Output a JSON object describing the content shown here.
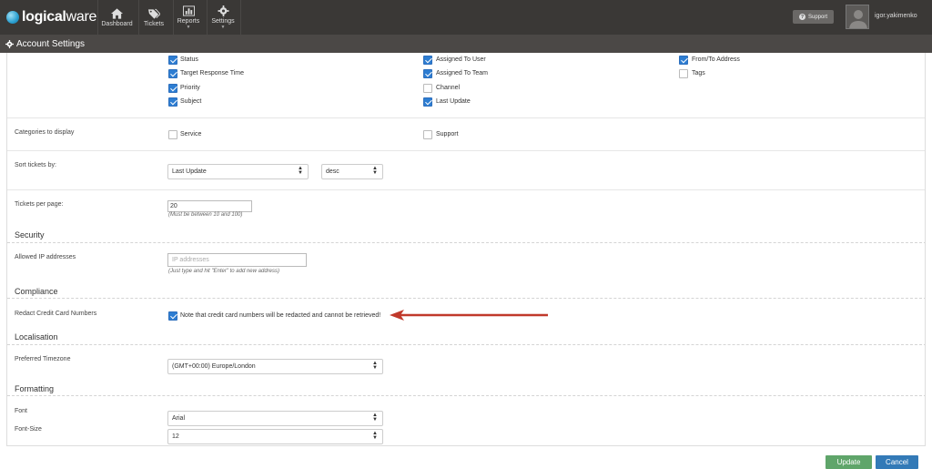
{
  "header": {
    "logo_bold": "logical",
    "logo_thin": "ware",
    "nav": [
      {
        "label": "Dashboard",
        "icon": "home-icon"
      },
      {
        "label": "Tickets",
        "icon": "tags-icon"
      },
      {
        "label": "Reports",
        "icon": "bar-chart-icon"
      },
      {
        "label": "Settings",
        "icon": "gear-icon"
      }
    ],
    "support_label": "Support",
    "username": "igor.yakimenko"
  },
  "page_title": "Account Settings",
  "columns_to_display": [
    {
      "label": "Status",
      "checked": true
    },
    {
      "label": "Assigned To User",
      "checked": true
    },
    {
      "label": "From/To Address",
      "checked": true
    },
    {
      "label": "Target Response Time",
      "checked": true
    },
    {
      "label": "Assigned To Team",
      "checked": true
    },
    {
      "label": "Tags",
      "checked": false
    },
    {
      "label": "Priority",
      "checked": true
    },
    {
      "label": "Channel",
      "checked": false
    },
    {
      "label": "Subject",
      "checked": true
    },
    {
      "label": "Last Update",
      "checked": true
    }
  ],
  "categories": {
    "label": "Categories to display",
    "options": [
      {
        "label": "Service",
        "checked": false
      },
      {
        "label": "Support",
        "checked": false
      }
    ]
  },
  "sort": {
    "label": "Sort tickets by:",
    "field": "Last Update",
    "order": "desc"
  },
  "per_page": {
    "label": "Tickets per page:",
    "value": "20",
    "hint": "(Must be between 10 and 100)"
  },
  "security": {
    "heading": "Security",
    "ip_label": "Allowed IP addresses",
    "ip_placeholder": "IP addresses",
    "ip_hint": "(Just type and hit \"Enter\" to add new address)"
  },
  "compliance": {
    "heading": "Compliance",
    "label": "Redact Credit Card Numbers",
    "note": "Note that credit card numbers will be redacted and cannot be retrieved!",
    "checked": true,
    "arrow_color": "#c0392b"
  },
  "localisation": {
    "heading": "Localisation",
    "tz_label": "Preferred Timezone",
    "tz_value": "(GMT+00:00) Europe/London"
  },
  "formatting": {
    "heading": "Formatting",
    "font_label": "Font",
    "font_value": "Arial",
    "size_label": "Font-Size",
    "size_value": "12"
  },
  "actions": {
    "update_label": "Update",
    "cancel_label": "Cancel",
    "update_color": "#5cb85c",
    "cancel_color": "#337ab7"
  }
}
